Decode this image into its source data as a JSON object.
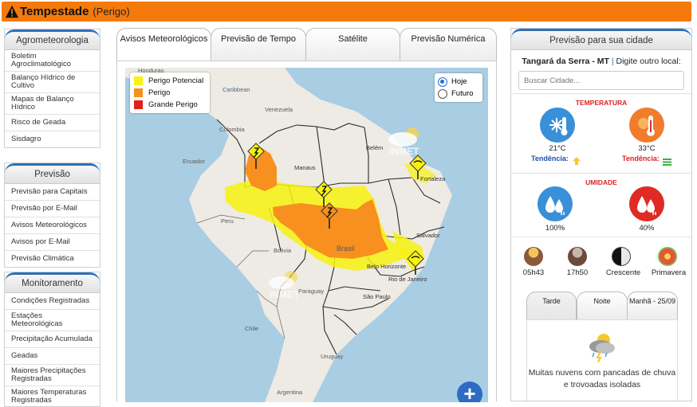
{
  "alert": {
    "title": "Tempestade",
    "level": "(Perigo)",
    "color": "#f47a0b"
  },
  "sidebar": {
    "agro": {
      "header": "Agrometeorologia",
      "items": [
        "Boletim Agroclimatológico",
        "Balanço Hídrico de Cultivo",
        "Mapas de Balanço Hídrico",
        "Risco de Geada",
        "Sisdagro"
      ]
    },
    "previsao": {
      "header": "Previsão",
      "items": [
        "Previsão para Capitais",
        "Previsão por E-Mail",
        "Avisos Meteorológicos",
        "Avisos por E-Mail",
        "Previsão Climática"
      ]
    },
    "monitoramento": {
      "header": "Monitoramento",
      "items": [
        "Condições Registradas",
        "Estações Meteorológicas",
        "Precipitação Acumulada",
        "Geadas",
        "Maiores Precipitações Registradas",
        "Maiores Temperaturas Registradas"
      ]
    }
  },
  "tabs": [
    "Avisos Meteorológicos",
    "Previsão de Tempo",
    "Satélite",
    "Previsão Numérica"
  ],
  "map": {
    "legend": [
      {
        "label": "Perigo Potencial",
        "color": "#f7f20e"
      },
      {
        "label": "Perigo",
        "color": "#f7901e"
      },
      {
        "label": "Grande Perigo",
        "color": "#e0201b"
      }
    ],
    "time_options": [
      "Hoje",
      "Futuro"
    ],
    "selected_time": "Hoje",
    "watermark": "INMET",
    "labels": [
      "Honduras",
      "Caribbean",
      "Venezuela",
      "Colombia",
      "Ecuador",
      "Peru",
      "Manaus",
      "Belém",
      "Fortaleza",
      "Salvador",
      "Bolivia",
      "Paraguay",
      "Belo Horizonte",
      "Rio de Janeiro",
      "São Paulo",
      "Brasil",
      "Chile",
      "Argentina",
      "Uruguay"
    ],
    "zoom_label": "+"
  },
  "city_panel": {
    "header": "Previsão para sua cidade",
    "city": "Tangará da Serra - MT",
    "other_prompt": "Digite outro local:",
    "search_placeholder": "Buscar Cidade...",
    "temperature": {
      "label": "TEMPERATURA",
      "min": "21°C",
      "max": "33°C",
      "trend_label": "Tendência:",
      "min_color": "#3a8fd9",
      "max_color": "#f07c2c"
    },
    "humidity": {
      "label": "UMIDADE",
      "min": "100%",
      "max": "40%",
      "min_color": "#3a8fd9",
      "max_color": "#e02a24"
    },
    "sun_moon": [
      {
        "label": "05h43",
        "icon": "sunrise-icon"
      },
      {
        "label": "17h50",
        "icon": "sunset-icon"
      },
      {
        "label": "Crescente",
        "icon": "moon-phase-icon"
      },
      {
        "label": "Primavera",
        "icon": "season-flower-icon"
      }
    ],
    "forecast_tabs": [
      "Tarde",
      "Noite",
      "Manhã - 25/09"
    ],
    "forecast_description": "Muitas nuvens com pancadas de chuva e trovoadas isoladas"
  }
}
